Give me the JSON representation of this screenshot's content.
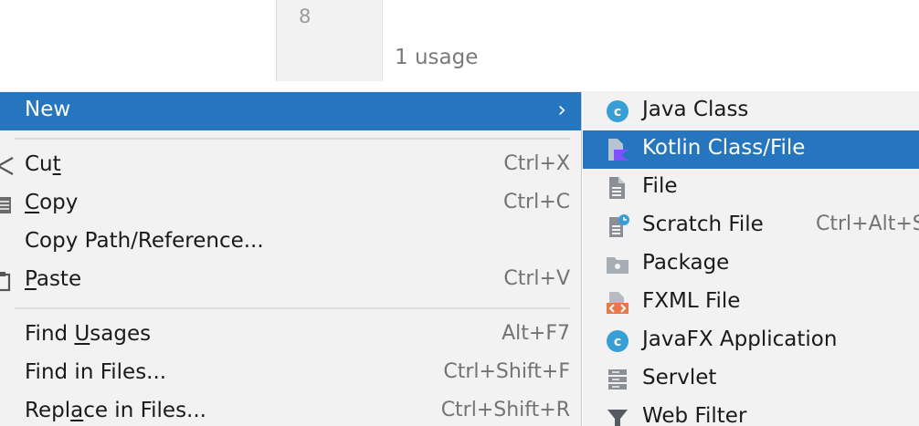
{
  "editor": {
    "line_number": "8",
    "usage_hint": "1 usage"
  },
  "context_menu": {
    "new": {
      "label": "New",
      "arrow": "›"
    },
    "cut": {
      "label_pre": "Cu",
      "label_u": "t",
      "label_post": "",
      "shortcut": "Ctrl+X"
    },
    "copy": {
      "label_pre": "",
      "label_u": "C",
      "label_post": "opy",
      "shortcut": "Ctrl+C"
    },
    "copy_path": {
      "label": "Copy Path/Reference..."
    },
    "paste": {
      "label_pre": "",
      "label_u": "P",
      "label_post": "aste",
      "shortcut": "Ctrl+V"
    },
    "find_usages": {
      "label_pre": "Find ",
      "label_u": "U",
      "label_post": "sages",
      "shortcut": "Alt+F7"
    },
    "find_in_files": {
      "label": "Find in Files...",
      "shortcut": "Ctrl+Shift+F"
    },
    "replace_in_files": {
      "label_pre": "Repl",
      "label_u": "a",
      "label_post": "ce in Files...",
      "shortcut": "Ctrl+Shift+R"
    }
  },
  "new_submenu": {
    "items": [
      {
        "label": "Java Class",
        "icon": "java-class-icon"
      },
      {
        "label": "Kotlin Class/File",
        "icon": "kotlin-file-icon"
      },
      {
        "label": "File",
        "icon": "file-icon"
      },
      {
        "label": "Scratch File",
        "icon": "scratch-file-icon",
        "shortcut": "Ctrl+Alt+Shift+Insert"
      },
      {
        "label": "Package",
        "icon": "package-folder-icon"
      },
      {
        "label": "FXML File",
        "icon": "fxml-file-icon"
      },
      {
        "label": "JavaFX Application",
        "icon": "javafx-class-icon"
      },
      {
        "label": "Servlet",
        "icon": "servlet-icon"
      },
      {
        "label": "Web Filter",
        "icon": "filter-icon"
      }
    ]
  },
  "colors": {
    "selection": "#2675bf",
    "menu_background": "#f2f2f2",
    "class_icon": "#389fd6",
    "kotlin_icon": "#7f52ff",
    "fxml_icon": "#e8784a"
  }
}
